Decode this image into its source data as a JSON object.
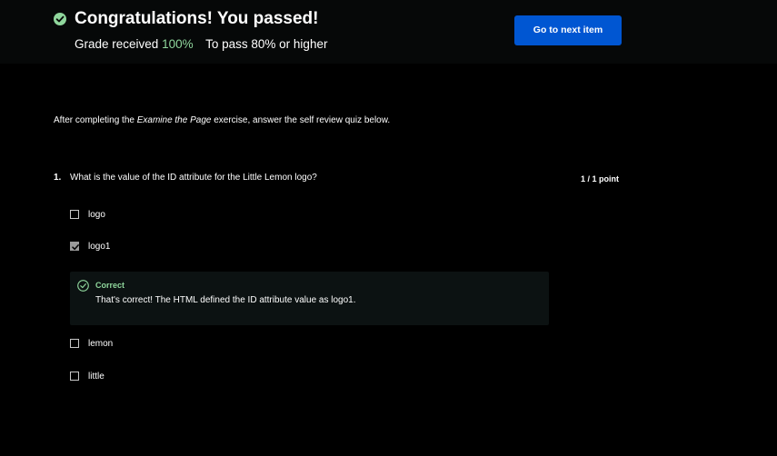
{
  "banner": {
    "title": "Congratulations! You passed!",
    "grade_label": "Grade received",
    "grade_value": "100%",
    "pass_text": "To pass 80% or higher",
    "next_button": "Go to next item"
  },
  "intro": {
    "before": "After completing the ",
    "emphasis": "Examine the Page",
    "after": " exercise, answer the self review quiz below."
  },
  "question": {
    "number": "1.",
    "text": "What is the value of the ID attribute for the Little Lemon logo?",
    "points": "1 / 1 point",
    "options": [
      {
        "label": "logo",
        "checked": false
      },
      {
        "label": "logo1",
        "checked": true
      },
      {
        "label": "lemon",
        "checked": false
      },
      {
        "label": "little",
        "checked": false
      }
    ],
    "feedback": {
      "title": "Correct",
      "text": "That's correct! The HTML defined the ID attribute value as logo1."
    }
  },
  "colors": {
    "accent": "#0056d2",
    "success": "#8fd69c",
    "background": "#000000"
  }
}
